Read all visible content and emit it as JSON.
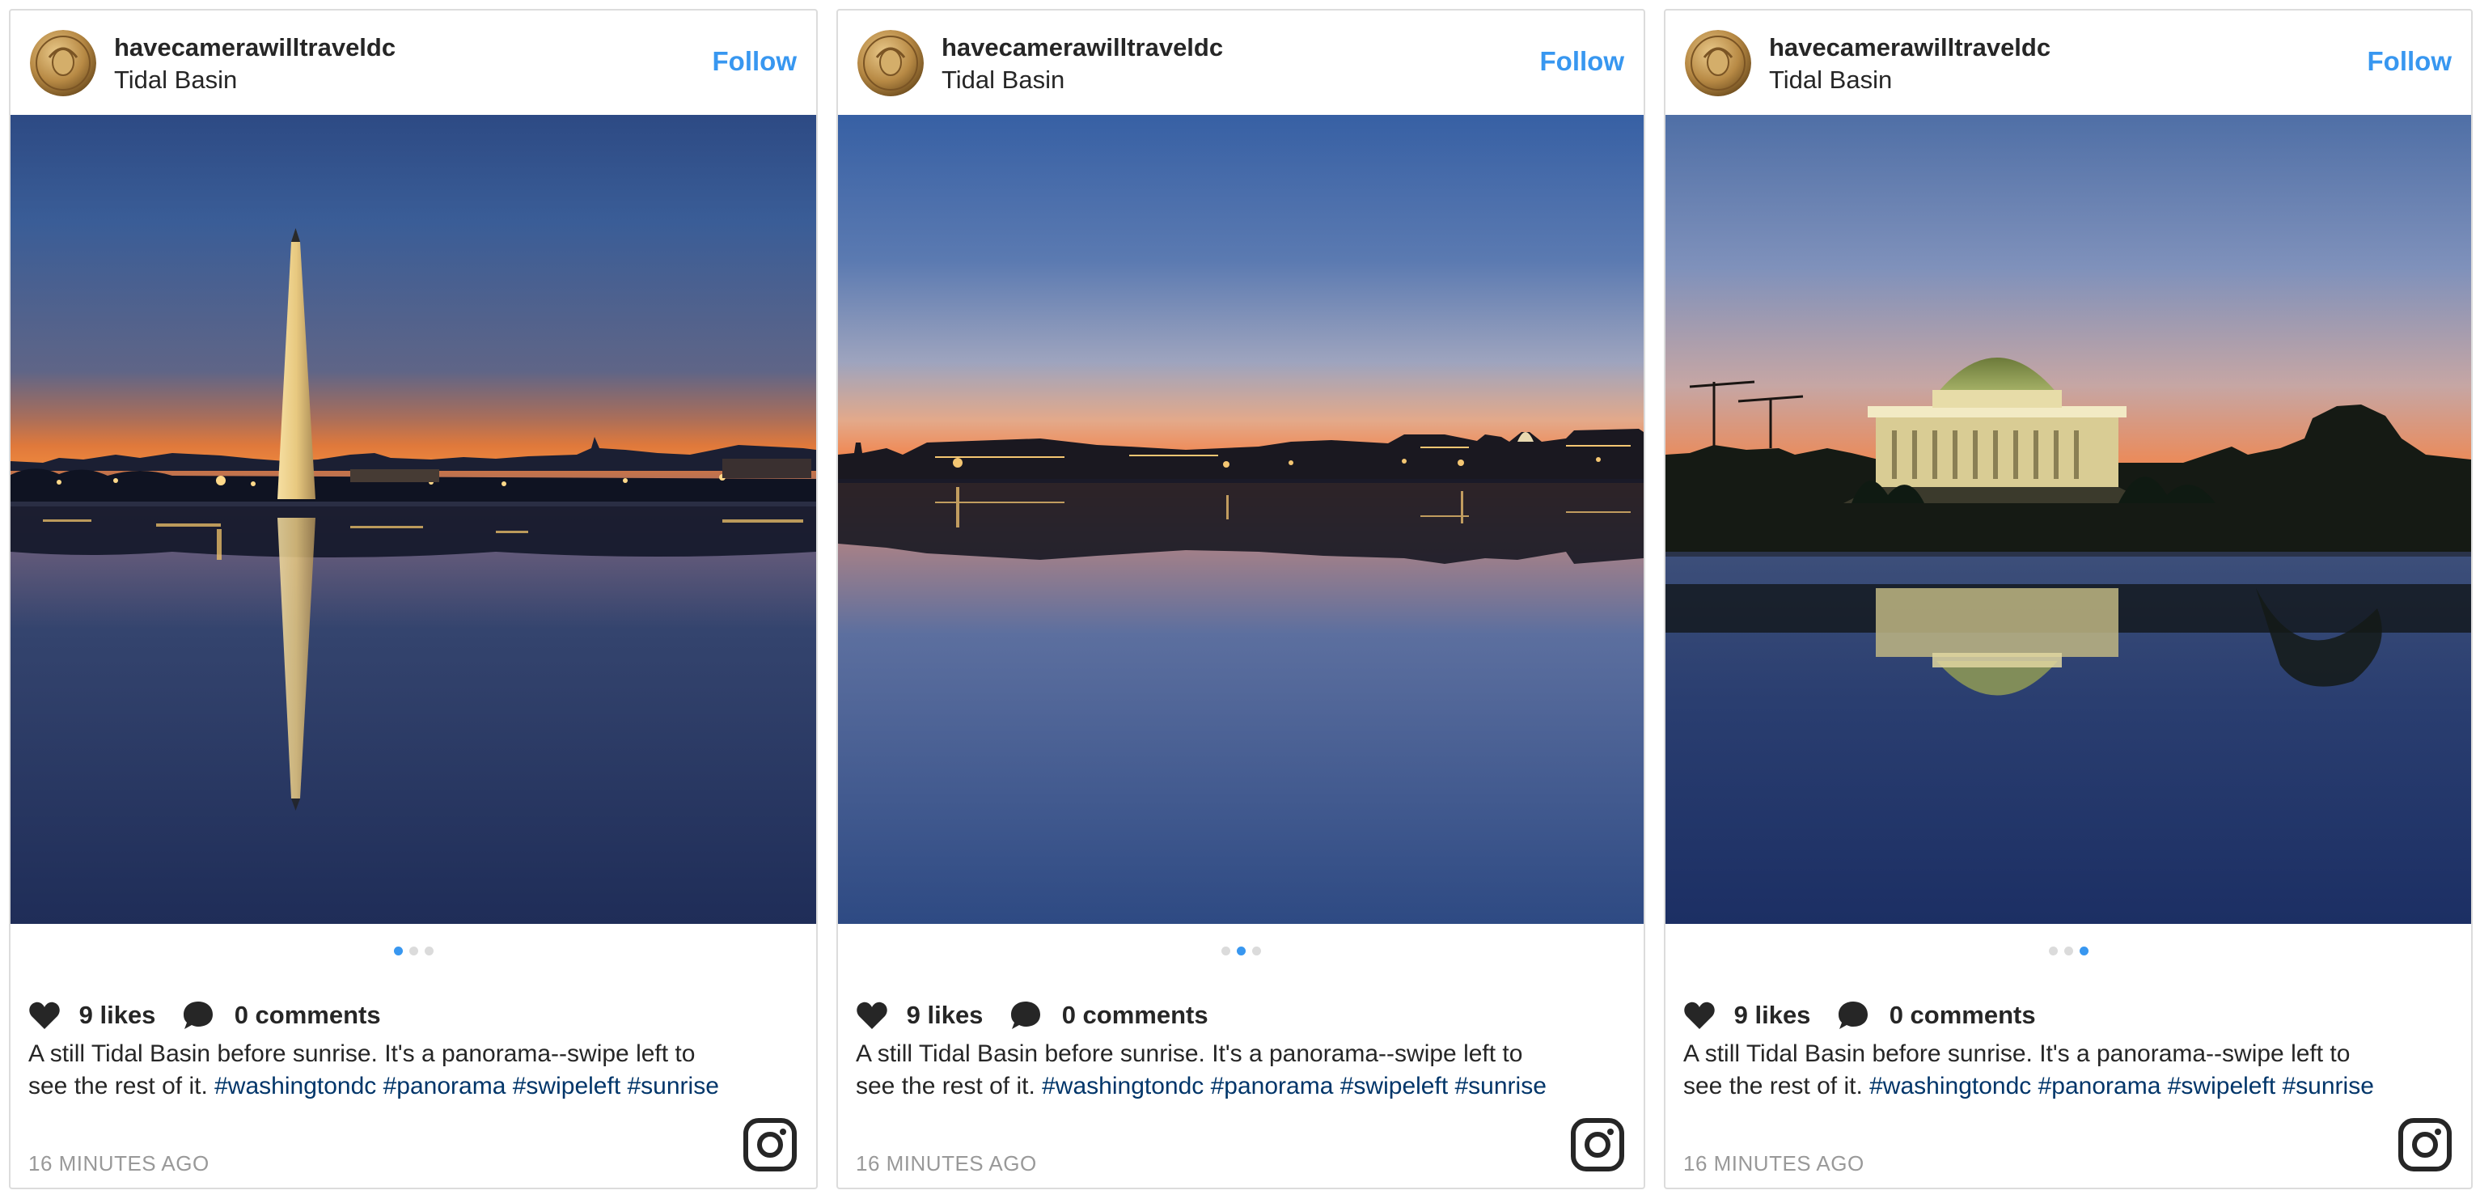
{
  "posts": [
    {
      "username": "havecamerawilltraveldc",
      "location": "Tidal Basin",
      "follow_label": "Follow",
      "likes": "9 likes",
      "comments": "0 comments",
      "caption_text": "A still Tidal Basin before sunrise. It's a panorama--swipe left to see the rest of it. ",
      "hashtags": [
        "#washingtondc",
        "#panorama",
        "#swipeleft",
        "#sunrise"
      ],
      "time": "16 MINUTES AGO",
      "carousel_active": 1,
      "carousel_count": 3,
      "photo_subject": "washington-monument-reflection"
    },
    {
      "username": "havecamerawilltraveldc",
      "location": "Tidal Basin",
      "follow_label": "Follow",
      "likes": "9 likes",
      "comments": "0 comments",
      "caption_text": "A still Tidal Basin before sunrise. It's a panorama--swipe left to see the rest of it. ",
      "hashtags": [
        "#washingtondc",
        "#panorama",
        "#swipeleft",
        "#sunrise"
      ],
      "time": "16 MINUTES AGO",
      "carousel_active": 2,
      "carousel_count": 3,
      "photo_subject": "city-skyline-reflection"
    },
    {
      "username": "havecamerawilltraveldc",
      "location": "Tidal Basin",
      "follow_label": "Follow",
      "likes": "9 likes",
      "comments": "0 comments",
      "caption_text": "A still Tidal Basin before sunrise. It's a panorama--swipe left to see the rest of it. ",
      "hashtags": [
        "#washingtondc",
        "#panorama",
        "#swipeleft",
        "#sunrise"
      ],
      "time": "16 MINUTES AGO",
      "carousel_active": 3,
      "carousel_count": 3,
      "photo_subject": "jefferson-memorial-reflection"
    }
  ],
  "icons": {
    "like": "heart-icon",
    "comment": "speech-bubble-icon",
    "brand": "instagram-logo-icon"
  },
  "colors": {
    "follow": "#3897f0",
    "hashtag": "#003569",
    "active_dot": "#3897f0",
    "inactive_dot": "#dbdbdb",
    "timestamp": "#999999"
  }
}
